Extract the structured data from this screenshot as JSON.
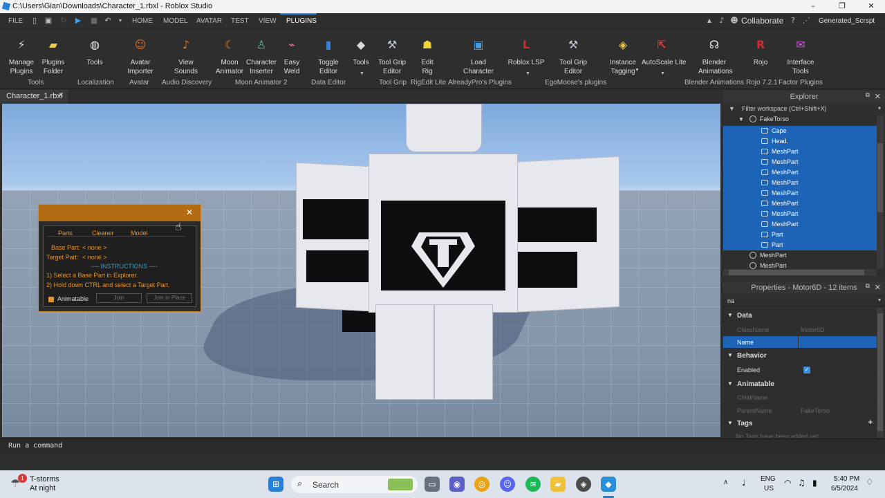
{
  "window": {
    "title": "C:\\Users\\Gian\\Downloads\\Character_1.rbxl - Roblox Studio",
    "minimize": "–",
    "maximize": "❐",
    "close": "✕"
  },
  "menubar": {
    "items": [
      "FILE",
      "HOME",
      "MODEL",
      "AVATAR",
      "TEST",
      "VIEW",
      "PLUGINS"
    ],
    "collaborate": "Collaborate",
    "user": "Generated_Scrspt"
  },
  "ribbon": {
    "buttons": [
      {
        "label": "Manage\nPlugins",
        "icon": "plug-icon",
        "color": "#dcdcdc"
      },
      {
        "label": "Plugins\nFolder",
        "icon": "folder-icon",
        "color": "#f3c94a"
      },
      {
        "label": "Tools",
        "icon": "globe-icon",
        "color": "#e8e8e8"
      },
      {
        "label": "Avatar\nImporter",
        "icon": "avatar-importer-icon",
        "color": "#e06a2c"
      },
      {
        "label": "View\nSounds",
        "icon": "speaker-icon",
        "color": "#e0762c"
      },
      {
        "label": "Moon\nAnimator",
        "icon": "moon-icon",
        "color": "#f08a1a"
      },
      {
        "label": "Character\nInserter",
        "icon": "character-icon",
        "color": "#5fbf8f"
      },
      {
        "label": "Easy\nWeld",
        "icon": "weld-icon",
        "color": "#e86a9a"
      },
      {
        "label": "Toggle\nEditor",
        "icon": "cylinder-icon",
        "color": "#3a7fd6"
      },
      {
        "label": "Tools",
        "icon": "block-icon",
        "color": "#d8d8d8"
      },
      {
        "label": "Tool Grip\nEditor",
        "icon": "tool-grip-icon",
        "color": "#bfc6d3"
      },
      {
        "label": "Edit\nRig",
        "icon": "rig-icon",
        "color": "#f2d13a"
      },
      {
        "label": "Load\nCharacter",
        "icon": "load-character-icon",
        "color": "#4a9ae0"
      },
      {
        "label": "Roblox LSP",
        "icon": "lsp-icon",
        "color": "#d82a2a"
      },
      {
        "label": "Tool Grip\nEditor",
        "icon": "tool-grip-icon-2",
        "color": "#bfc6d3"
      },
      {
        "label": "Instance\nTagging",
        "icon": "tag-icon",
        "color": "#f0c84a"
      },
      {
        "label": "AutoScale Lite",
        "icon": "autoscale-icon",
        "color": "#d83a3a"
      },
      {
        "label": "Blender\nAnimations",
        "icon": "blender-icon",
        "color": "#e8e8e8"
      },
      {
        "label": "Rojo",
        "icon": "rojo-icon",
        "color": "#d82a2a"
      },
      {
        "label": "Interface\nTools",
        "icon": "interface-icon",
        "color": "#c85ad8"
      }
    ],
    "groups": [
      "Tools",
      "Localization",
      "Avatar",
      "Audio Discovery",
      "Moon Animator 2",
      "Data Editor",
      "Tool Grip",
      "RigEdit Lite",
      "AlreadyPro's Plugins",
      "EgoMoose's plugins",
      "Blender Animations",
      "Rojo 7.2.1",
      "Factor Plugins"
    ]
  },
  "doc_tab": {
    "label": "Character_1.rbxl",
    "close": "✕"
  },
  "plugin_window": {
    "close": "✕",
    "tabs": [
      "Parts",
      "Cleaner",
      "Model"
    ],
    "base_label": "Base Part:",
    "base_value": "< none >",
    "target_label": "Target Part:",
    "target_value": "< none >",
    "instructions_header": "---- INSTRUCTIONS ----",
    "step1": "1) Select a Base Part in Explorer.",
    "step2": "2) Hold down CTRL and select a Target Part.",
    "animatable": "Animatable",
    "join": "Join",
    "join_in_place": "Join In Place"
  },
  "explorer": {
    "title": "Explorer",
    "filter_placeholder": "Filter workspace (Ctrl+Shift+X)",
    "root": "FakeTorso",
    "items": [
      {
        "name": "Cape",
        "selected": true
      },
      {
        "name": "Head.",
        "selected": true
      },
      {
        "name": "MeshPart",
        "selected": true
      },
      {
        "name": "MeshPart",
        "selected": true
      },
      {
        "name": "MeshPart",
        "selected": true
      },
      {
        "name": "MeshPart",
        "selected": true
      },
      {
        "name": "MeshPart",
        "selected": true
      },
      {
        "name": "MeshPart",
        "selected": true
      },
      {
        "name": "MeshPart",
        "selected": true
      },
      {
        "name": "MeshPart",
        "selected": true
      },
      {
        "name": "Part",
        "selected": true
      },
      {
        "name": "Part",
        "selected": true
      }
    ],
    "siblings": [
      "MeshPart",
      "MeshPart"
    ]
  },
  "properties": {
    "title": "Properties - Motor6D - 12 items",
    "filter_value": "na",
    "sections": {
      "data": "Data",
      "behavior": "Behavior",
      "animatable": "Animatable",
      "tags": "Tags"
    },
    "classname_key": "ClassName",
    "classname_val": "Motor6D",
    "name_key": "Name",
    "enabled_key": "Enabled",
    "childname_key": "ChildName",
    "parentname_key": "ParentName",
    "parentname_val": "FakeTorso",
    "tags_empty": "No Tags have been added yet"
  },
  "command_bar": {
    "placeholder": "Run a command"
  },
  "taskbar": {
    "weather_badge": "1",
    "weather_title": "T-storms",
    "weather_sub": "At night",
    "search": "Search",
    "lang1": "ENG",
    "lang2": "US",
    "time": "5:40 PM",
    "date": "6/5/2024"
  },
  "colors": {
    "accent": "#3a8dde",
    "selection": "#1d64b6",
    "plugin_orange": "#b36b14"
  }
}
